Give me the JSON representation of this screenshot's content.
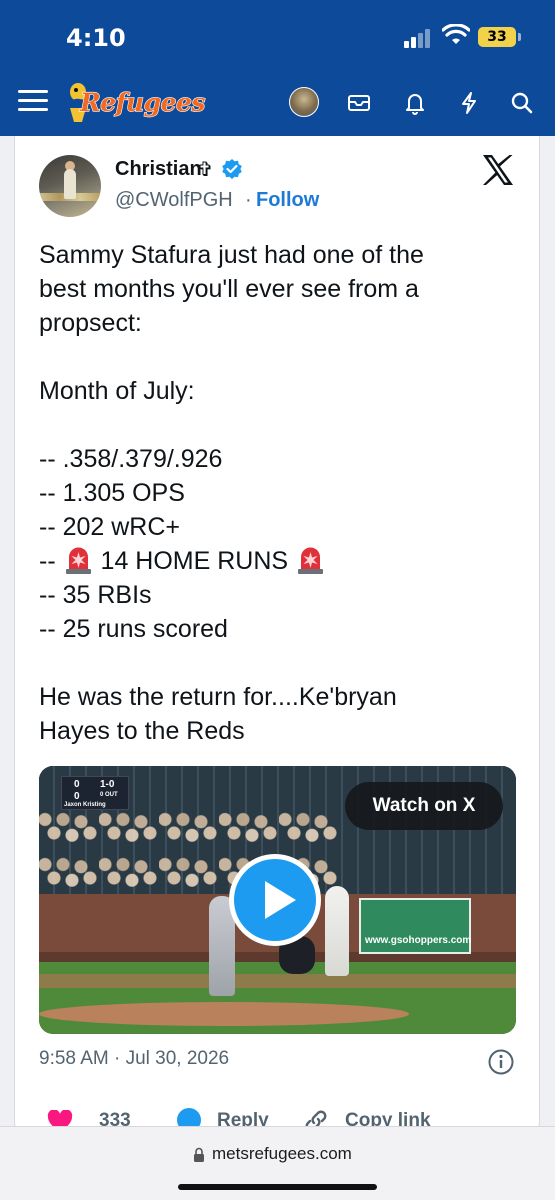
{
  "status_bar": {
    "time": "4:10",
    "battery": "33"
  },
  "header": {
    "logo_text": "Refugees",
    "icons": [
      "menu-icon",
      "avatar",
      "mail-icon",
      "bell-icon",
      "bolt-icon",
      "search-icon"
    ]
  },
  "tweet": {
    "author_name": "Christian",
    "author_symbol": "✞",
    "handle": "@CWolfPGH",
    "separator": "·",
    "follow_label": "Follow",
    "lines": [
      "Sammy Stafura just had one of the",
      "best months you'll ever see from a",
      "propsect:",
      "",
      "Month of July:",
      "",
      "-- .358/.379/.926",
      "-- 1.305 OPS",
      "-- 202 wRC+",
      "-- ",
      "-- 35 RBIs",
      "-- 25 runs scored",
      "",
      "He was the return for....Ke'bryan",
      "Hayes to the Reds"
    ],
    "home_runs_text": " 14 HOME RUNS ",
    "video": {
      "watch_label": "Watch on X",
      "scorebug_count": "1-0",
      "scorebug_outs": "0 OUT",
      "scorebug_scores": [
        "0",
        "0"
      ],
      "scorebug_name": "Jaxon Kristing",
      "sign_site": "www.gsohoppers.com"
    },
    "timestamp": "9:58 AM · Jul 30, 2026",
    "likes": "333",
    "reply_label": "Reply",
    "copy_label": "Copy link"
  },
  "browser": {
    "url": "metsrefugees.com"
  },
  "colors": {
    "header_blue": "#0d4a9a",
    "link_blue": "#1d7bd7",
    "play_blue": "#1d9bf0",
    "heart": "#f91880",
    "logo_orange": "#f26a21"
  }
}
